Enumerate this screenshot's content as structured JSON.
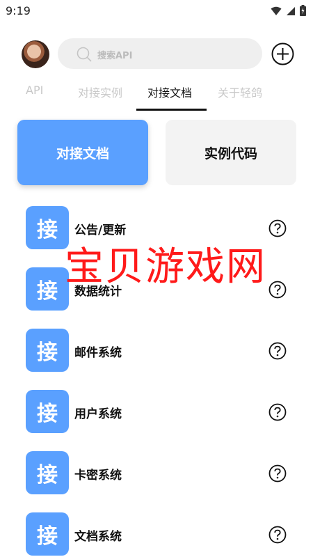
{
  "status": {
    "time": "9:19"
  },
  "search": {
    "placeholder": "搜索API"
  },
  "tabs": [
    {
      "label": "API"
    },
    {
      "label": "对接实例"
    },
    {
      "label": "对接文档"
    },
    {
      "label": "关于轻鸽"
    }
  ],
  "active_tab": "对接文档",
  "buttons": {
    "primary": "对接文档",
    "secondary": "实例代码"
  },
  "list": {
    "icon_char": "接",
    "items": [
      {
        "label": "公告/更新"
      },
      {
        "label": "数据统计"
      },
      {
        "label": "邮件系统"
      },
      {
        "label": "用户系统"
      },
      {
        "label": "卡密系统"
      },
      {
        "label": "文档系统"
      }
    ]
  },
  "watermark": "宝贝游戏网",
  "colors": {
    "accent": "#5aa0ff",
    "watermark": "#ff1a1a"
  }
}
